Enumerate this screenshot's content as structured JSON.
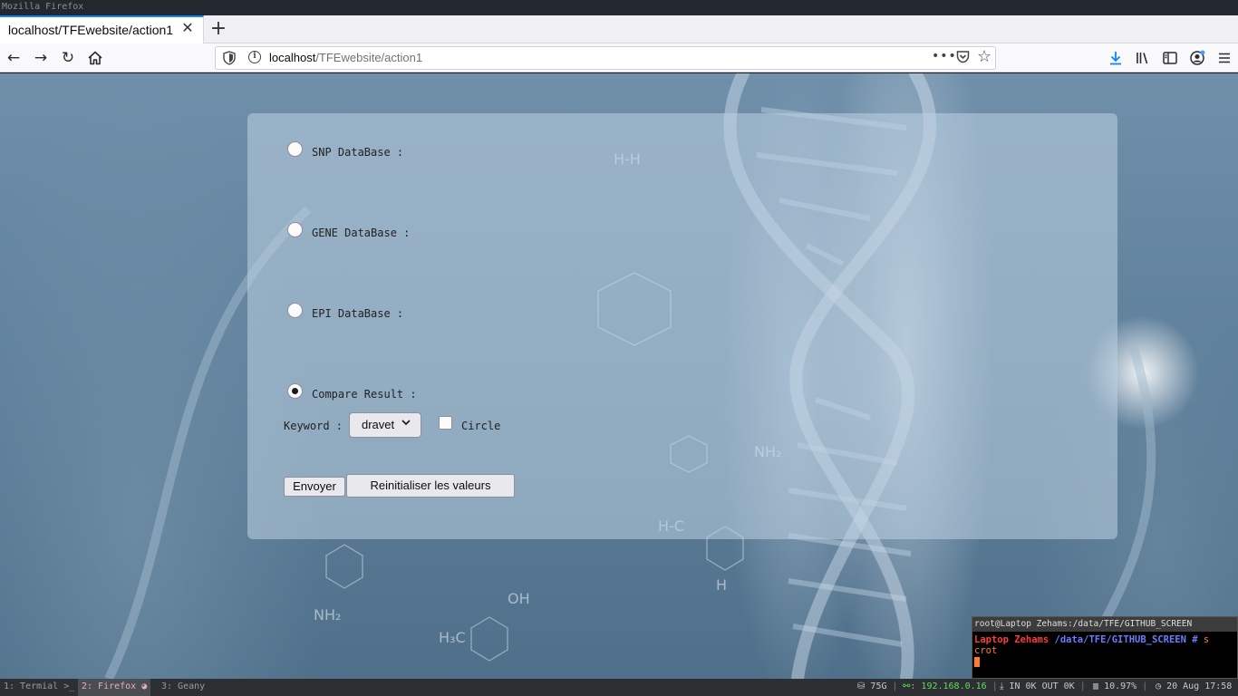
{
  "wm": {
    "title": "Mozilla Firefox"
  },
  "browser": {
    "tab_title": "localhost/TFEwebsite/action1",
    "url_host": "localhost",
    "url_path": "/TFEwebsite/action1",
    "url_more": "•••"
  },
  "form": {
    "options": [
      {
        "label": "SNP DataBase :",
        "checked": false
      },
      {
        "label": "GENE DataBase :",
        "checked": false
      },
      {
        "label": "EPI DataBase :",
        "checked": false
      },
      {
        "label": "Compare Result :",
        "checked": true
      }
    ],
    "keyword_label": "Keyword :",
    "keyword_value": "dravet",
    "circle_label": "Circle",
    "circle_checked": false,
    "submit_label": "Envoyer",
    "reset_label": "Reinitialiser les valeurs"
  },
  "terminal": {
    "title": "root@Laptop Zehams:/data/TFE/GITHUB_SCREEN",
    "prompt_host": "Laptop Zehams",
    "prompt_path": " /data/TFE/GITHUB_SCREEN # ",
    "cmd_line1": "s",
    "cmd_line2": "crot"
  },
  "statusbar": {
    "workspaces": [
      {
        "label": "1: Termial >_",
        "active": false
      },
      {
        "label": "2: Firefox",
        "active": true
      },
      {
        "label": "3: Geany",
        "active": false
      }
    ],
    "disk": "75G",
    "ip": ": 192.168.0.16",
    "net": "IN 0K OUT 0K",
    "cpu": "10.97%",
    "datetime": "20 Aug 17:58"
  },
  "colors": {
    "accent": "#0a84ff",
    "terminal_host": "#ff3b3b",
    "terminal_path": "#6b7cff",
    "status_green": "#5fdc5f"
  }
}
